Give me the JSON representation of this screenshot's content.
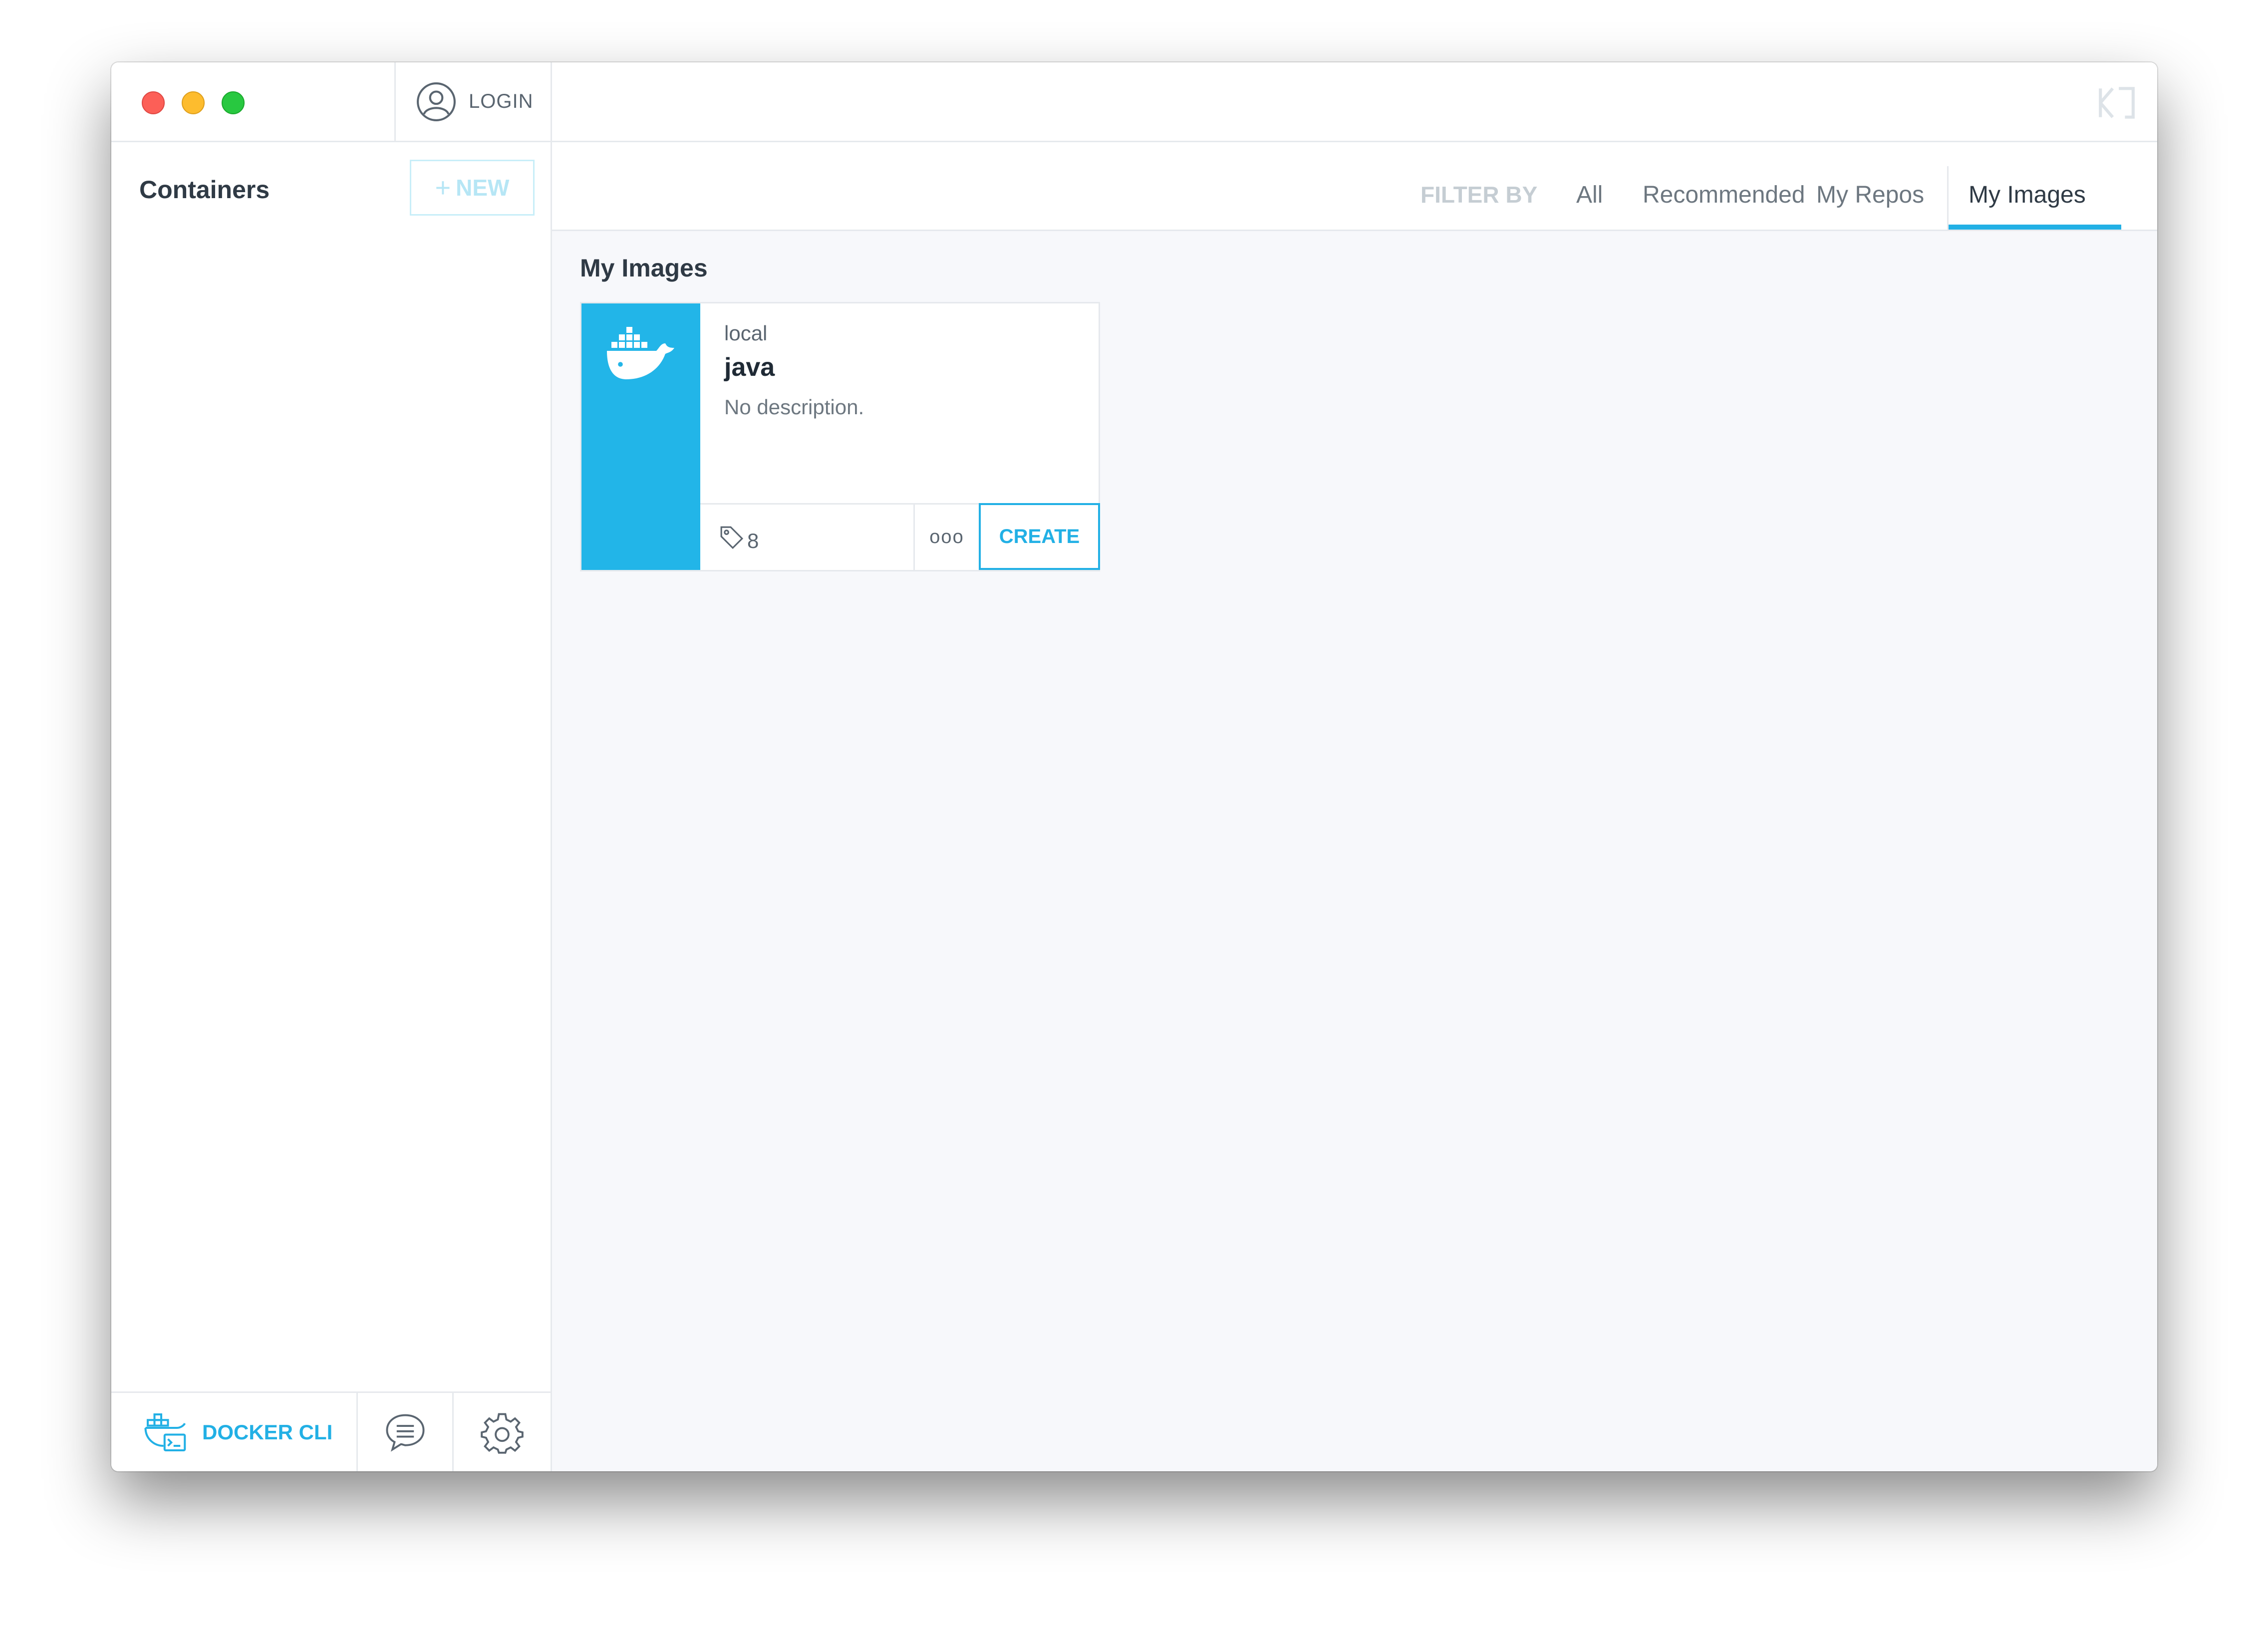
{
  "sidebar": {
    "login_label": "LOGIN",
    "title": "Containers",
    "new_button": "NEW",
    "new_plus": "+",
    "docker_cli": "DOCKER CLI"
  },
  "filter": {
    "label": "FILTER BY",
    "items": [
      "All",
      "Recommended",
      "My Repos",
      "My Images"
    ],
    "active": "My Images"
  },
  "section": {
    "title": "My Images"
  },
  "card": {
    "namespace": "local",
    "name": "java",
    "description": "No description.",
    "tag_count": "8",
    "more": "ooo",
    "create": "CREATE"
  },
  "colors": {
    "accent": "#22b0e5",
    "card_logo_bg": "#22b5e8",
    "traffic_red": "#fc5f57",
    "traffic_yellow": "#fdbc2e",
    "traffic_green": "#28c840"
  },
  "icons": {
    "user": "user-circle-icon",
    "docker_cli": "docker-terminal-icon",
    "chat": "chat-bubble-icon",
    "settings": "gear-icon",
    "tag": "tag-icon",
    "whale": "docker-whale-icon",
    "brand": "kitematic-logo-icon"
  }
}
